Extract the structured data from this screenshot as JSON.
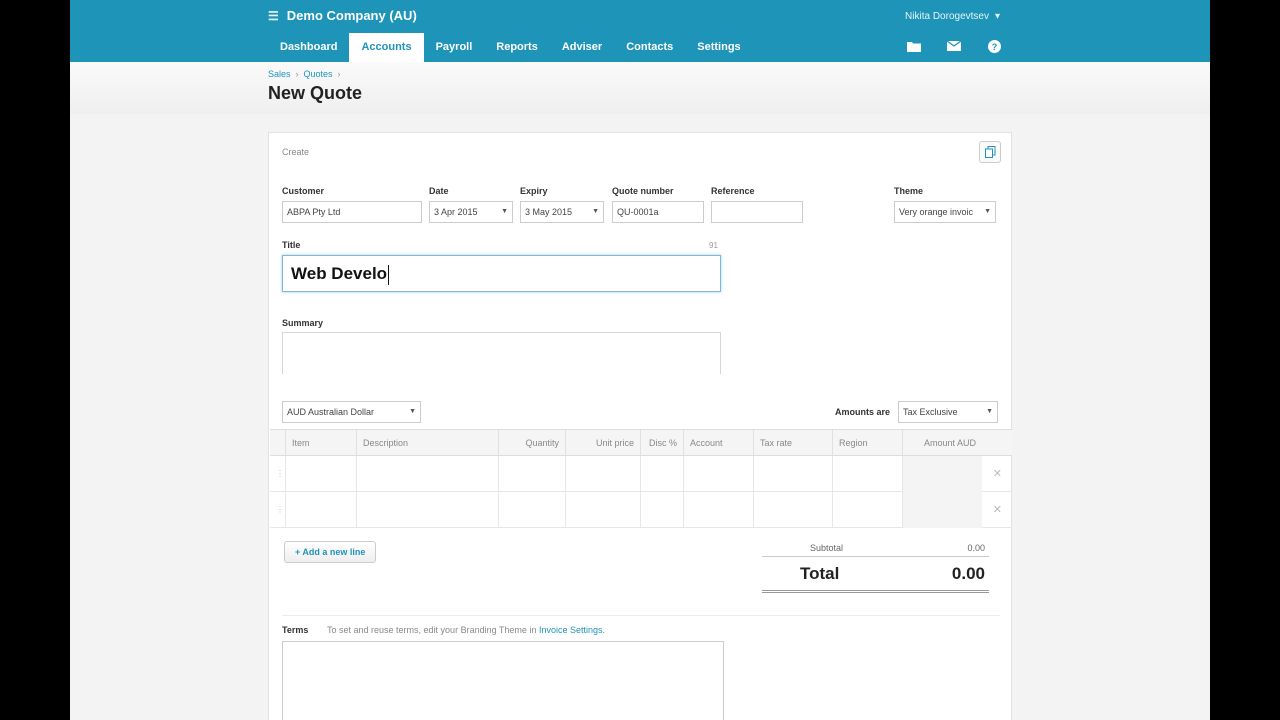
{
  "org": {
    "name": "Demo Company (AU)"
  },
  "user": {
    "name": "Nikita Dorogevtsev"
  },
  "nav": [
    "Dashboard",
    "Accounts",
    "Payroll",
    "Reports",
    "Adviser",
    "Contacts",
    "Settings"
  ],
  "nav_active": "Accounts",
  "icons": {
    "menu": "list-icon",
    "files": "folder-icon",
    "mail": "mail-icon",
    "help": "help-icon",
    "copy": "copy-icon"
  },
  "breadcrumb": [
    "Sales",
    "Quotes"
  ],
  "page_title": "New Quote",
  "status": "Create",
  "form": {
    "customer": {
      "label": "Customer",
      "value": "ABPA Pty Ltd"
    },
    "date": {
      "label": "Date",
      "value": "3 Apr 2015"
    },
    "expiry": {
      "label": "Expiry",
      "value": "3 May 2015"
    },
    "quote_number": {
      "label": "Quote number",
      "value": "QU-0001a"
    },
    "reference": {
      "label": "Reference",
      "value": ""
    },
    "theme": {
      "label": "Theme",
      "value": "Very orange invoic"
    },
    "title": {
      "label": "Title",
      "value": "Web Develo",
      "counter": "91"
    },
    "summary": {
      "label": "Summary",
      "value": ""
    }
  },
  "currency": "AUD Australian Dollar",
  "amounts_are": {
    "label": "Amounts are",
    "value": "Tax Exclusive"
  },
  "columns": [
    "Item",
    "Description",
    "Quantity",
    "Unit price",
    "Disc %",
    "Account",
    "Tax rate",
    "Region",
    "Amount AUD"
  ],
  "add_line": "+ Add a new line",
  "totals": {
    "subtotal_label": "Subtotal",
    "subtotal": "0.00",
    "total_label": "Total",
    "total": "0.00"
  },
  "terms": {
    "label": "Terms",
    "help": "To set and reuse terms, edit your Branding Theme in",
    "link": "Invoice Settings."
  },
  "colors": {
    "brand": "#1f94b9"
  }
}
